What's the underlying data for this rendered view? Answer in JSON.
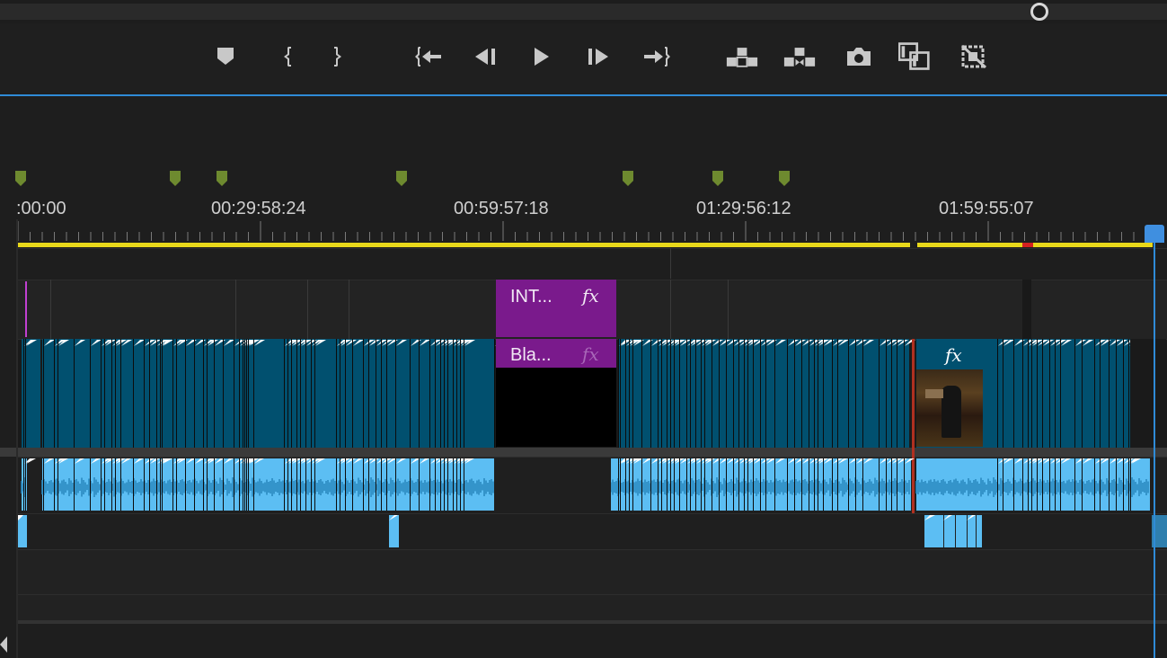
{
  "timecodes": [
    ":00:00",
    "00:29:58:24",
    "00:59:57:18",
    "01:29:56:12",
    "01:59:55:07"
  ],
  "transport": {
    "buttons": [
      "add-marker",
      "mark-in",
      "mark-out",
      "go-to-in",
      "step-back",
      "play",
      "step-forward",
      "go-to-out",
      "lift",
      "extract",
      "export-frame",
      "insert",
      "overwrite"
    ]
  },
  "clips": {
    "v2_title": "INT...",
    "v1_black": "Bla...",
    "fx": "fx"
  },
  "colors": {
    "accent_blue": "#2f8bd7",
    "video_clip": "#01506f",
    "audio_clip": "#5cbef3",
    "title_clip": "#7a1a8c",
    "work_area": "#e8d81a",
    "marker": "#6e8a2f"
  }
}
